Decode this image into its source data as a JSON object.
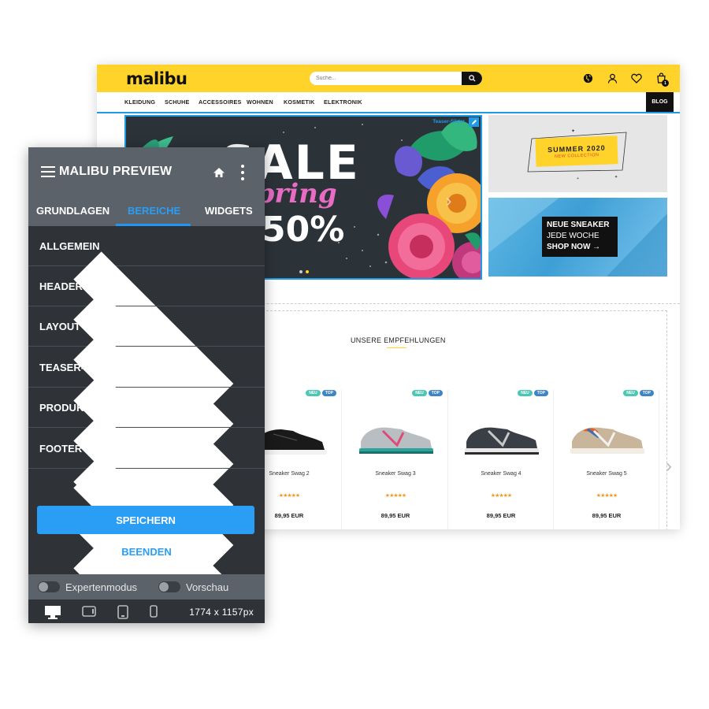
{
  "shop": {
    "logo": "malibu",
    "search_placeholder": "Suche...",
    "cart_count": "1",
    "nav": [
      "KLEIDUNG",
      "SCHUHE",
      "ACCESSOIRES",
      "WOHNEN",
      "KOSMETIK",
      "ELEKTRONIK"
    ],
    "blog": "BLOG",
    "slider": {
      "label": "Teaser-Slider",
      "sale": "SALE",
      "spring": "Spring",
      "percent": "50%"
    },
    "teaser_summer": {
      "title": "SUMMER 2020",
      "subtitle": "NEW COLLECTION"
    },
    "teaser_sneaker": {
      "line1": "NEUE SNEAKER",
      "line2": "JEDE WOCHE",
      "line3": "SHOP NOW →"
    },
    "recommendations": {
      "title": "UNSERE EMPFEHLUNGEN",
      "badges": {
        "new": "NEU",
        "top": "TOP"
      },
      "products": [
        {
          "name": "Sneaker Swag 2",
          "stars": "★★★★★",
          "price": "89,95 EUR"
        },
        {
          "name": "Sneaker Swag 3",
          "stars": "★★★★★",
          "price": "89,95 EUR"
        },
        {
          "name": "Sneaker Swag 4",
          "stars": "★★★★★",
          "price": "89,95 EUR"
        },
        {
          "name": "Sneaker Swag 5",
          "stars": "★★★★★",
          "price": "89,95 EUR"
        }
      ]
    }
  },
  "editor": {
    "title": "MALIBU PREVIEW",
    "tabs": [
      "GRUNDLAGEN",
      "BEREICHE",
      "WIDGETS"
    ],
    "active_tab": "BEREICHE",
    "items": [
      "ALLGEMEIN",
      "HEADER",
      "LAYOUT",
      "TEASER-SLIDER",
      "PRODUKTSEITE",
      "FOOTER"
    ],
    "save_label": "SPEICHERN",
    "end_label": "BEENDEN",
    "toggles": [
      {
        "label": "Expertenmodus",
        "on": false
      },
      {
        "label": "Vorschau",
        "on": false
      }
    ],
    "resolution": "1774 x 1157px"
  },
  "colors": {
    "brand_yellow": "#ffd32a",
    "accent_blue": "#2a9df4",
    "panel_dark": "#2f3338",
    "panel_grey": "#5b6269"
  }
}
